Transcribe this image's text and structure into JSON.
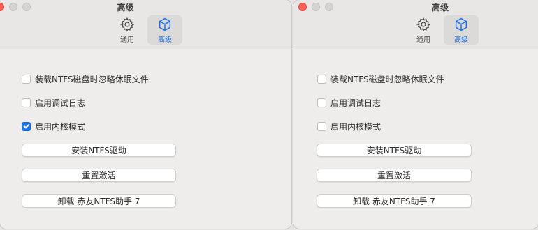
{
  "windows": [
    {
      "title": "高级",
      "tabs": [
        {
          "label": "通用",
          "icon": "gear-icon",
          "active": false
        },
        {
          "label": "高级",
          "icon": "cube-icon",
          "active": true
        }
      ],
      "options": [
        {
          "label": "装载NTFS磁盘时忽略休眠文件",
          "checked": false
        },
        {
          "label": "启用调试日志",
          "checked": false
        },
        {
          "label": "启用内核模式",
          "checked": true
        }
      ],
      "buttons": [
        {
          "label": "安装NTFS驱动"
        },
        {
          "label": "重置激活"
        },
        {
          "label": "卸载 赤友NTFS助手 7"
        }
      ]
    },
    {
      "title": "高级",
      "tabs": [
        {
          "label": "通用",
          "icon": "gear-icon",
          "active": false
        },
        {
          "label": "高级",
          "icon": "cube-icon",
          "active": true
        }
      ],
      "options": [
        {
          "label": "装载NTFS磁盘时忽略休眠文件",
          "checked": false
        },
        {
          "label": "启用调试日志",
          "checked": false
        },
        {
          "label": "启用内核模式",
          "checked": false
        }
      ],
      "buttons": [
        {
          "label": "安装NTFS驱动"
        },
        {
          "label": "重置激活"
        },
        {
          "label": "卸载 赤友NTFS助手 7"
        }
      ]
    }
  ],
  "colors": {
    "accent": "#1a73e8",
    "close": "#ff5f57"
  }
}
